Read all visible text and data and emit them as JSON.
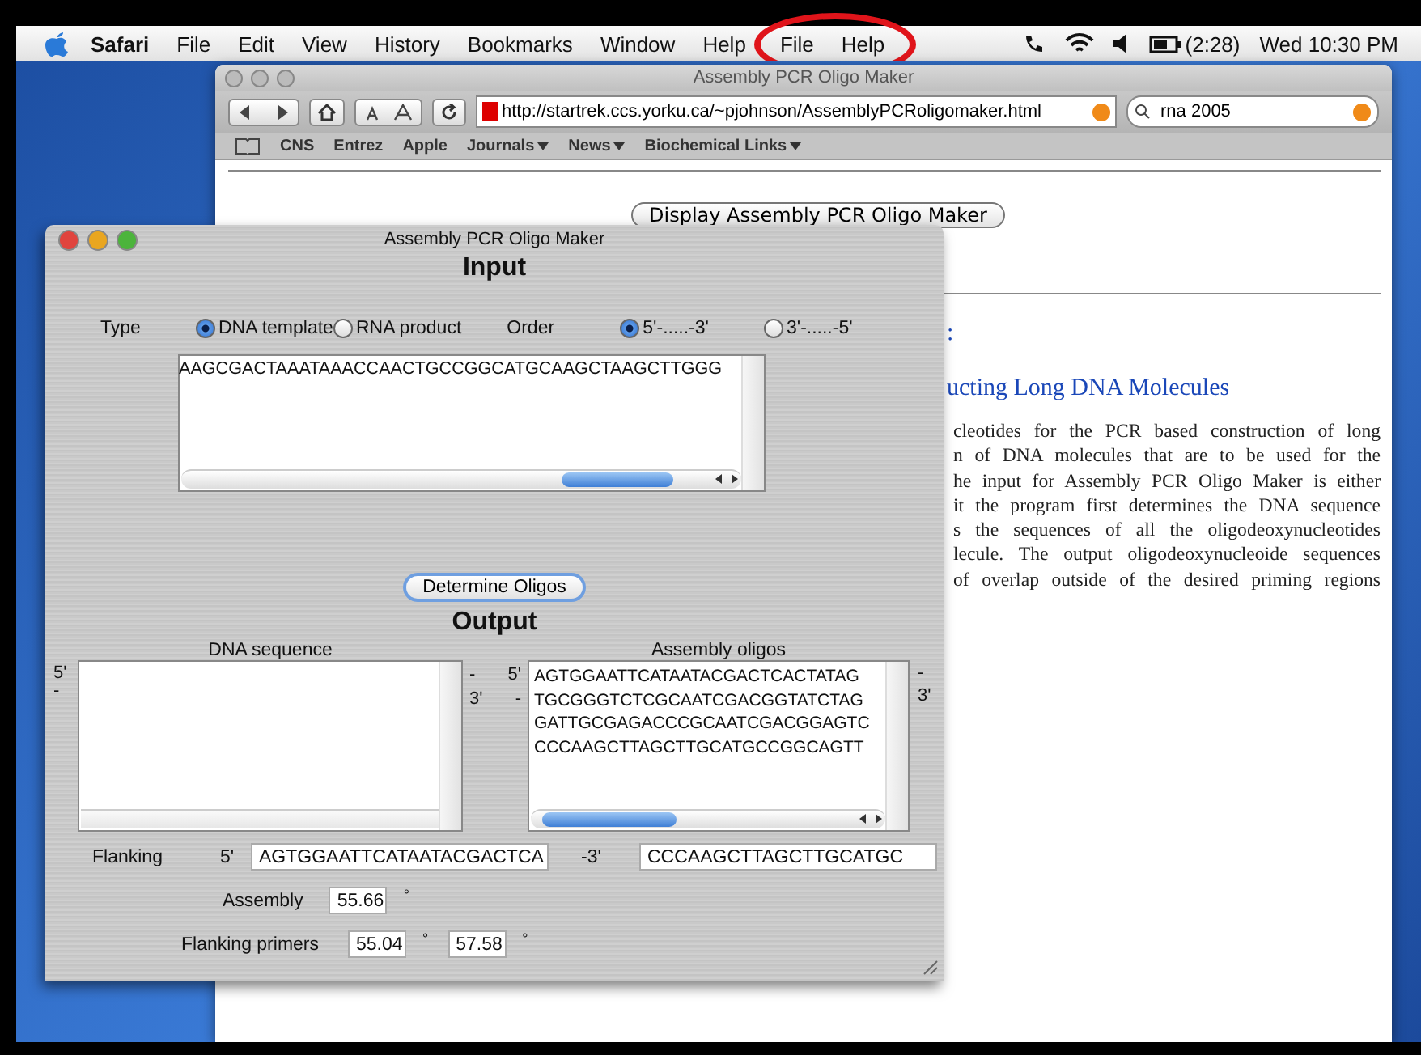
{
  "menu_bar": {
    "app": "Safari",
    "items": [
      "File",
      "Edit",
      "View",
      "History",
      "Bookmarks",
      "Window",
      "Help",
      "File",
      "Help"
    ],
    "battery": "(2:28)",
    "clock": "Wed 10:30 PM"
  },
  "browser": {
    "title": "Assembly PCR Oligo Maker",
    "address": "http://startrek.ccs.yorku.ca/~pjohnson/AssemblyPCRoligomaker.html",
    "search": "rna 2005",
    "bookmarks": [
      {
        "label": "CNS",
        "menu": false
      },
      {
        "label": "Entrez",
        "menu": false
      },
      {
        "label": "Apple",
        "menu": false
      },
      {
        "label": "Journals",
        "menu": true
      },
      {
        "label": "News",
        "menu": true
      },
      {
        "label": "Biochemical Links",
        "menu": true
      }
    ],
    "page": {
      "button": "Display Assembly PCR Oligo Maker",
      "link_fragment": ":",
      "heading": "ucting Long DNA Molecules",
      "lines": [
        "cleotides for the PCR based construction of long",
        "n of DNA molecules that are to be used for the",
        "he input for Assembly PCR Oligo Maker is either",
        "it the program first determines the DNA sequence",
        "s the sequences of all the oligodeoxynucleotides",
        "lecule. The output oligodeoxynucleoide sequences",
        "of overlap outside of the desired priming regions"
      ]
    }
  },
  "applet": {
    "title": "Assembly PCR Oligo Maker",
    "input_heading": "Input",
    "type_label": "Type",
    "types": [
      {
        "label": "DNA template",
        "selected": true
      },
      {
        "label": "RNA product",
        "selected": false
      }
    ],
    "order_label": "Order",
    "orders": [
      {
        "label": "5'-.....-3'",
        "selected": true
      },
      {
        "label": "3'-.....-5'",
        "selected": false
      }
    ],
    "input_sequence": "AAGCGACTAAATAAACCAACTGCCGGCATGCAAGCTAAGCTTGGG",
    "determine_button": "Determine Oligos",
    "output_heading": "Output",
    "dna_label": "DNA sequence",
    "oligos_label": "Assembly oligos",
    "left_marks": [
      "5'",
      "-"
    ],
    "middle_marks": [
      [
        "-",
        "5'"
      ],
      [
        "3'",
        "-"
      ]
    ],
    "right_marks": [
      "-",
      "3'"
    ],
    "oligos": [
      "AGTGGAATTCATAATACGACTCACTATAG",
      "TGCGGGTCTCGCAATCGACGGTATCTAG",
      "GATTGCGAGACCCGCAATCGACGGAGTC",
      "CCCAAGCTTAGCTTGCATGCCGGCAGTT"
    ],
    "flanking_label": "Flanking",
    "flank_5": "5'",
    "flank_5_value": "AGTGGAATTCATAATACGACTCA",
    "flank_3": "-3'",
    "flank_3_value": "CCCAAGCTTAGCTTGCATGC",
    "assembly_label": "Assembly",
    "assembly_value": "55.66",
    "assembly_unit": "°",
    "primers_label": "Flanking primers",
    "primer_values": [
      {
        "value": "55.04",
        "unit": "°"
      },
      {
        "value": "57.58",
        "unit": "°"
      }
    ]
  }
}
